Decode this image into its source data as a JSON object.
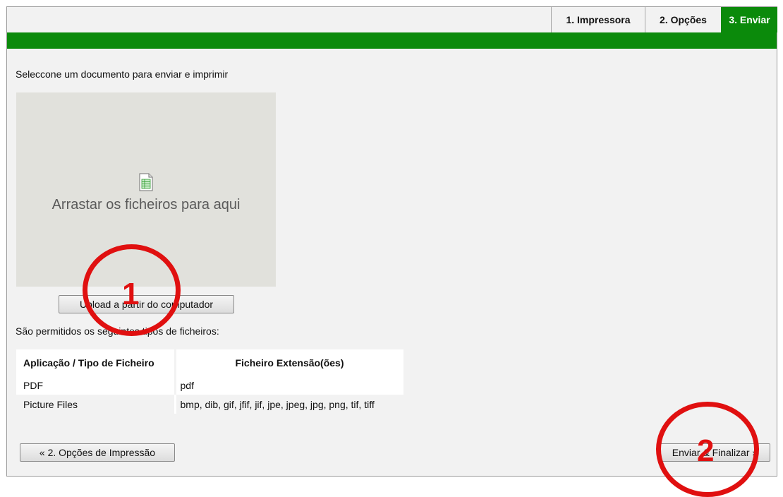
{
  "tabs": [
    {
      "label": "1. Impressora",
      "active": false
    },
    {
      "label": "2. Opções",
      "active": false
    },
    {
      "label": "3. Enviar",
      "active": true
    }
  ],
  "colors": {
    "accent": "#0b8a0b",
    "annotation": "#e01010",
    "dropzone": "#e1e1dc"
  },
  "upload": {
    "instruction": "Seleccone um documento para enviar e imprimir",
    "dropzone_icon": "document-icon",
    "dropzone_text": "Arrastar os ficheiros para aqui",
    "button_label": "Upload a partir do computador"
  },
  "allowed_text": "São permitidos os seguintes tipos de ficheiros:",
  "filetypes": {
    "headers": [
      "Aplicação / Tipo de Ficheiro",
      "Ficheiro Extensão(ões)"
    ],
    "rows": [
      [
        "PDF",
        "pdf"
      ],
      [
        "Picture Files",
        "bmp, dib, gif, jfif, jif, jpe, jpeg, jpg, png, tif, tiff"
      ]
    ]
  },
  "nav": {
    "back_label": "« 2. Opções de Impressão",
    "next_label": "Enviar & Finalizar »"
  },
  "annotations": [
    "1",
    "2"
  ]
}
